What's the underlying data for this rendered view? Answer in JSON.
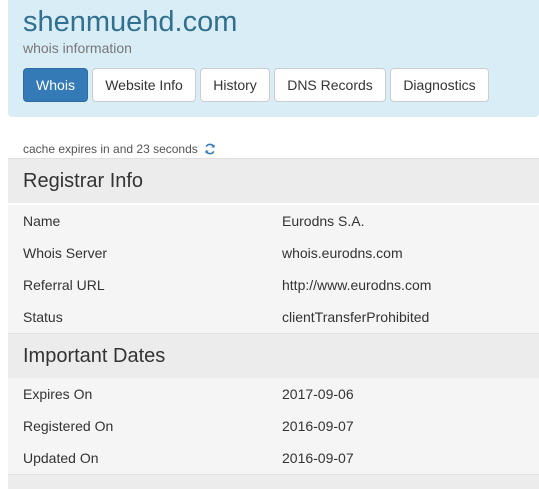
{
  "header": {
    "title": "shenmuehd.com",
    "subtitle": "whois information"
  },
  "tabs": [
    {
      "label": "Whois",
      "active": true
    },
    {
      "label": "Website Info",
      "active": false
    },
    {
      "label": "History",
      "active": false
    },
    {
      "label": "DNS Records",
      "active": false
    },
    {
      "label": "Diagnostics",
      "active": false
    }
  ],
  "cache": {
    "text": "cache expires in and 23 seconds",
    "icon": "refresh-icon"
  },
  "registrar": {
    "heading": "Registrar Info",
    "rows": [
      {
        "key": "Name",
        "value": "Eurodns S.A."
      },
      {
        "key": "Whois Server",
        "value": "whois.eurodns.com"
      },
      {
        "key": "Referral URL",
        "value": "http://www.eurodns.com"
      },
      {
        "key": "Status",
        "value": "clientTransferProhibited"
      }
    ]
  },
  "dates": {
    "heading": "Important Dates",
    "rows": [
      {
        "key": "Expires On",
        "value": "2017-09-06"
      },
      {
        "key": "Registered On",
        "value": "2016-09-07"
      },
      {
        "key": "Updated On",
        "value": "2016-09-07"
      }
    ]
  },
  "colors": {
    "accent": "#337ab7",
    "header_bg": "#d9edf7",
    "title": "#31708f"
  }
}
